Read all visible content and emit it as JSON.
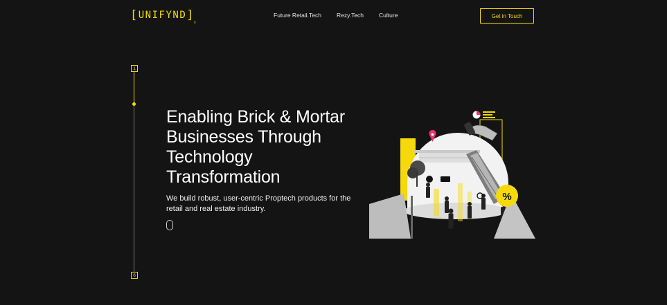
{
  "header": {
    "logo": "UNIFYND",
    "nav": [
      "Future Retail.Tech",
      "Rezy.Tech",
      "Culture"
    ],
    "cta_label": "Get in Touch"
  },
  "indicator": {
    "current": "1",
    "total": "6"
  },
  "hero": {
    "title_lines": [
      "Enabling Brick & Mortar",
      "Businesses Through",
      "Technology",
      "Transformation"
    ],
    "subtitle": "We build robust, user-centric Proptech products for the retail and real estate industry."
  },
  "colors": {
    "background": "#141414",
    "accent": "#f5d90a",
    "text": "#ffffff",
    "marker": "#e8336d"
  },
  "icons": [
    "scroll-mouse-icon",
    "location-pin-icon",
    "percent-badge-icon",
    "pie-chart-icon"
  ]
}
